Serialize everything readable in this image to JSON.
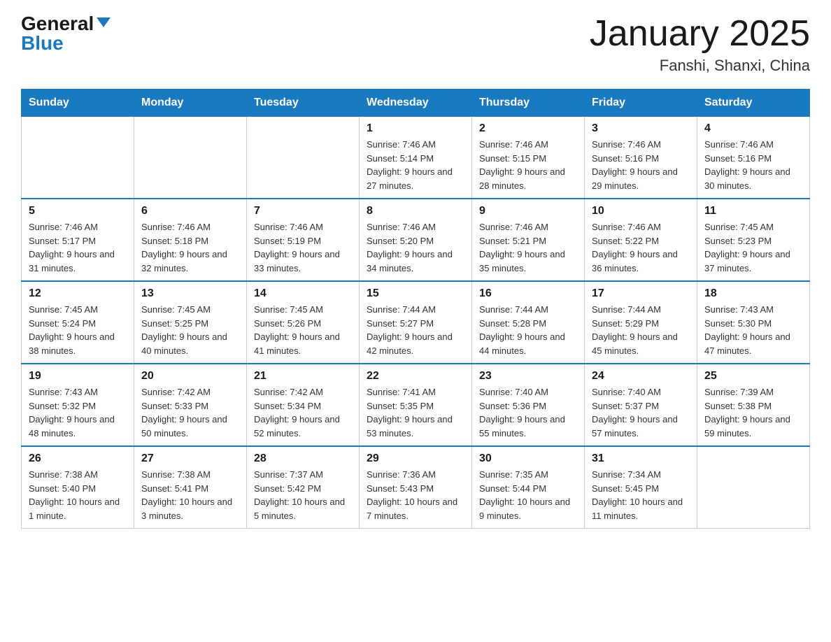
{
  "logo": {
    "general": "General",
    "blue": "Blue"
  },
  "title": "January 2025",
  "location": "Fanshi, Shanxi, China",
  "weekdays": [
    "Sunday",
    "Monday",
    "Tuesday",
    "Wednesday",
    "Thursday",
    "Friday",
    "Saturday"
  ],
  "weeks": [
    [
      {
        "day": "",
        "sunrise": "",
        "sunset": "",
        "daylight": ""
      },
      {
        "day": "",
        "sunrise": "",
        "sunset": "",
        "daylight": ""
      },
      {
        "day": "",
        "sunrise": "",
        "sunset": "",
        "daylight": ""
      },
      {
        "day": "1",
        "sunrise": "Sunrise: 7:46 AM",
        "sunset": "Sunset: 5:14 PM",
        "daylight": "Daylight: 9 hours and 27 minutes."
      },
      {
        "day": "2",
        "sunrise": "Sunrise: 7:46 AM",
        "sunset": "Sunset: 5:15 PM",
        "daylight": "Daylight: 9 hours and 28 minutes."
      },
      {
        "day": "3",
        "sunrise": "Sunrise: 7:46 AM",
        "sunset": "Sunset: 5:16 PM",
        "daylight": "Daylight: 9 hours and 29 minutes."
      },
      {
        "day": "4",
        "sunrise": "Sunrise: 7:46 AM",
        "sunset": "Sunset: 5:16 PM",
        "daylight": "Daylight: 9 hours and 30 minutes."
      }
    ],
    [
      {
        "day": "5",
        "sunrise": "Sunrise: 7:46 AM",
        "sunset": "Sunset: 5:17 PM",
        "daylight": "Daylight: 9 hours and 31 minutes."
      },
      {
        "day": "6",
        "sunrise": "Sunrise: 7:46 AM",
        "sunset": "Sunset: 5:18 PM",
        "daylight": "Daylight: 9 hours and 32 minutes."
      },
      {
        "day": "7",
        "sunrise": "Sunrise: 7:46 AM",
        "sunset": "Sunset: 5:19 PM",
        "daylight": "Daylight: 9 hours and 33 minutes."
      },
      {
        "day": "8",
        "sunrise": "Sunrise: 7:46 AM",
        "sunset": "Sunset: 5:20 PM",
        "daylight": "Daylight: 9 hours and 34 minutes."
      },
      {
        "day": "9",
        "sunrise": "Sunrise: 7:46 AM",
        "sunset": "Sunset: 5:21 PM",
        "daylight": "Daylight: 9 hours and 35 minutes."
      },
      {
        "day": "10",
        "sunrise": "Sunrise: 7:46 AM",
        "sunset": "Sunset: 5:22 PM",
        "daylight": "Daylight: 9 hours and 36 minutes."
      },
      {
        "day": "11",
        "sunrise": "Sunrise: 7:45 AM",
        "sunset": "Sunset: 5:23 PM",
        "daylight": "Daylight: 9 hours and 37 minutes."
      }
    ],
    [
      {
        "day": "12",
        "sunrise": "Sunrise: 7:45 AM",
        "sunset": "Sunset: 5:24 PM",
        "daylight": "Daylight: 9 hours and 38 minutes."
      },
      {
        "day": "13",
        "sunrise": "Sunrise: 7:45 AM",
        "sunset": "Sunset: 5:25 PM",
        "daylight": "Daylight: 9 hours and 40 minutes."
      },
      {
        "day": "14",
        "sunrise": "Sunrise: 7:45 AM",
        "sunset": "Sunset: 5:26 PM",
        "daylight": "Daylight: 9 hours and 41 minutes."
      },
      {
        "day": "15",
        "sunrise": "Sunrise: 7:44 AM",
        "sunset": "Sunset: 5:27 PM",
        "daylight": "Daylight: 9 hours and 42 minutes."
      },
      {
        "day": "16",
        "sunrise": "Sunrise: 7:44 AM",
        "sunset": "Sunset: 5:28 PM",
        "daylight": "Daylight: 9 hours and 44 minutes."
      },
      {
        "day": "17",
        "sunrise": "Sunrise: 7:44 AM",
        "sunset": "Sunset: 5:29 PM",
        "daylight": "Daylight: 9 hours and 45 minutes."
      },
      {
        "day": "18",
        "sunrise": "Sunrise: 7:43 AM",
        "sunset": "Sunset: 5:30 PM",
        "daylight": "Daylight: 9 hours and 47 minutes."
      }
    ],
    [
      {
        "day": "19",
        "sunrise": "Sunrise: 7:43 AM",
        "sunset": "Sunset: 5:32 PM",
        "daylight": "Daylight: 9 hours and 48 minutes."
      },
      {
        "day": "20",
        "sunrise": "Sunrise: 7:42 AM",
        "sunset": "Sunset: 5:33 PM",
        "daylight": "Daylight: 9 hours and 50 minutes."
      },
      {
        "day": "21",
        "sunrise": "Sunrise: 7:42 AM",
        "sunset": "Sunset: 5:34 PM",
        "daylight": "Daylight: 9 hours and 52 minutes."
      },
      {
        "day": "22",
        "sunrise": "Sunrise: 7:41 AM",
        "sunset": "Sunset: 5:35 PM",
        "daylight": "Daylight: 9 hours and 53 minutes."
      },
      {
        "day": "23",
        "sunrise": "Sunrise: 7:40 AM",
        "sunset": "Sunset: 5:36 PM",
        "daylight": "Daylight: 9 hours and 55 minutes."
      },
      {
        "day": "24",
        "sunrise": "Sunrise: 7:40 AM",
        "sunset": "Sunset: 5:37 PM",
        "daylight": "Daylight: 9 hours and 57 minutes."
      },
      {
        "day": "25",
        "sunrise": "Sunrise: 7:39 AM",
        "sunset": "Sunset: 5:38 PM",
        "daylight": "Daylight: 9 hours and 59 minutes."
      }
    ],
    [
      {
        "day": "26",
        "sunrise": "Sunrise: 7:38 AM",
        "sunset": "Sunset: 5:40 PM",
        "daylight": "Daylight: 10 hours and 1 minute."
      },
      {
        "day": "27",
        "sunrise": "Sunrise: 7:38 AM",
        "sunset": "Sunset: 5:41 PM",
        "daylight": "Daylight: 10 hours and 3 minutes."
      },
      {
        "day": "28",
        "sunrise": "Sunrise: 7:37 AM",
        "sunset": "Sunset: 5:42 PM",
        "daylight": "Daylight: 10 hours and 5 minutes."
      },
      {
        "day": "29",
        "sunrise": "Sunrise: 7:36 AM",
        "sunset": "Sunset: 5:43 PM",
        "daylight": "Daylight: 10 hours and 7 minutes."
      },
      {
        "day": "30",
        "sunrise": "Sunrise: 7:35 AM",
        "sunset": "Sunset: 5:44 PM",
        "daylight": "Daylight: 10 hours and 9 minutes."
      },
      {
        "day": "31",
        "sunrise": "Sunrise: 7:34 AM",
        "sunset": "Sunset: 5:45 PM",
        "daylight": "Daylight: 10 hours and 11 minutes."
      },
      {
        "day": "",
        "sunrise": "",
        "sunset": "",
        "daylight": ""
      }
    ]
  ]
}
